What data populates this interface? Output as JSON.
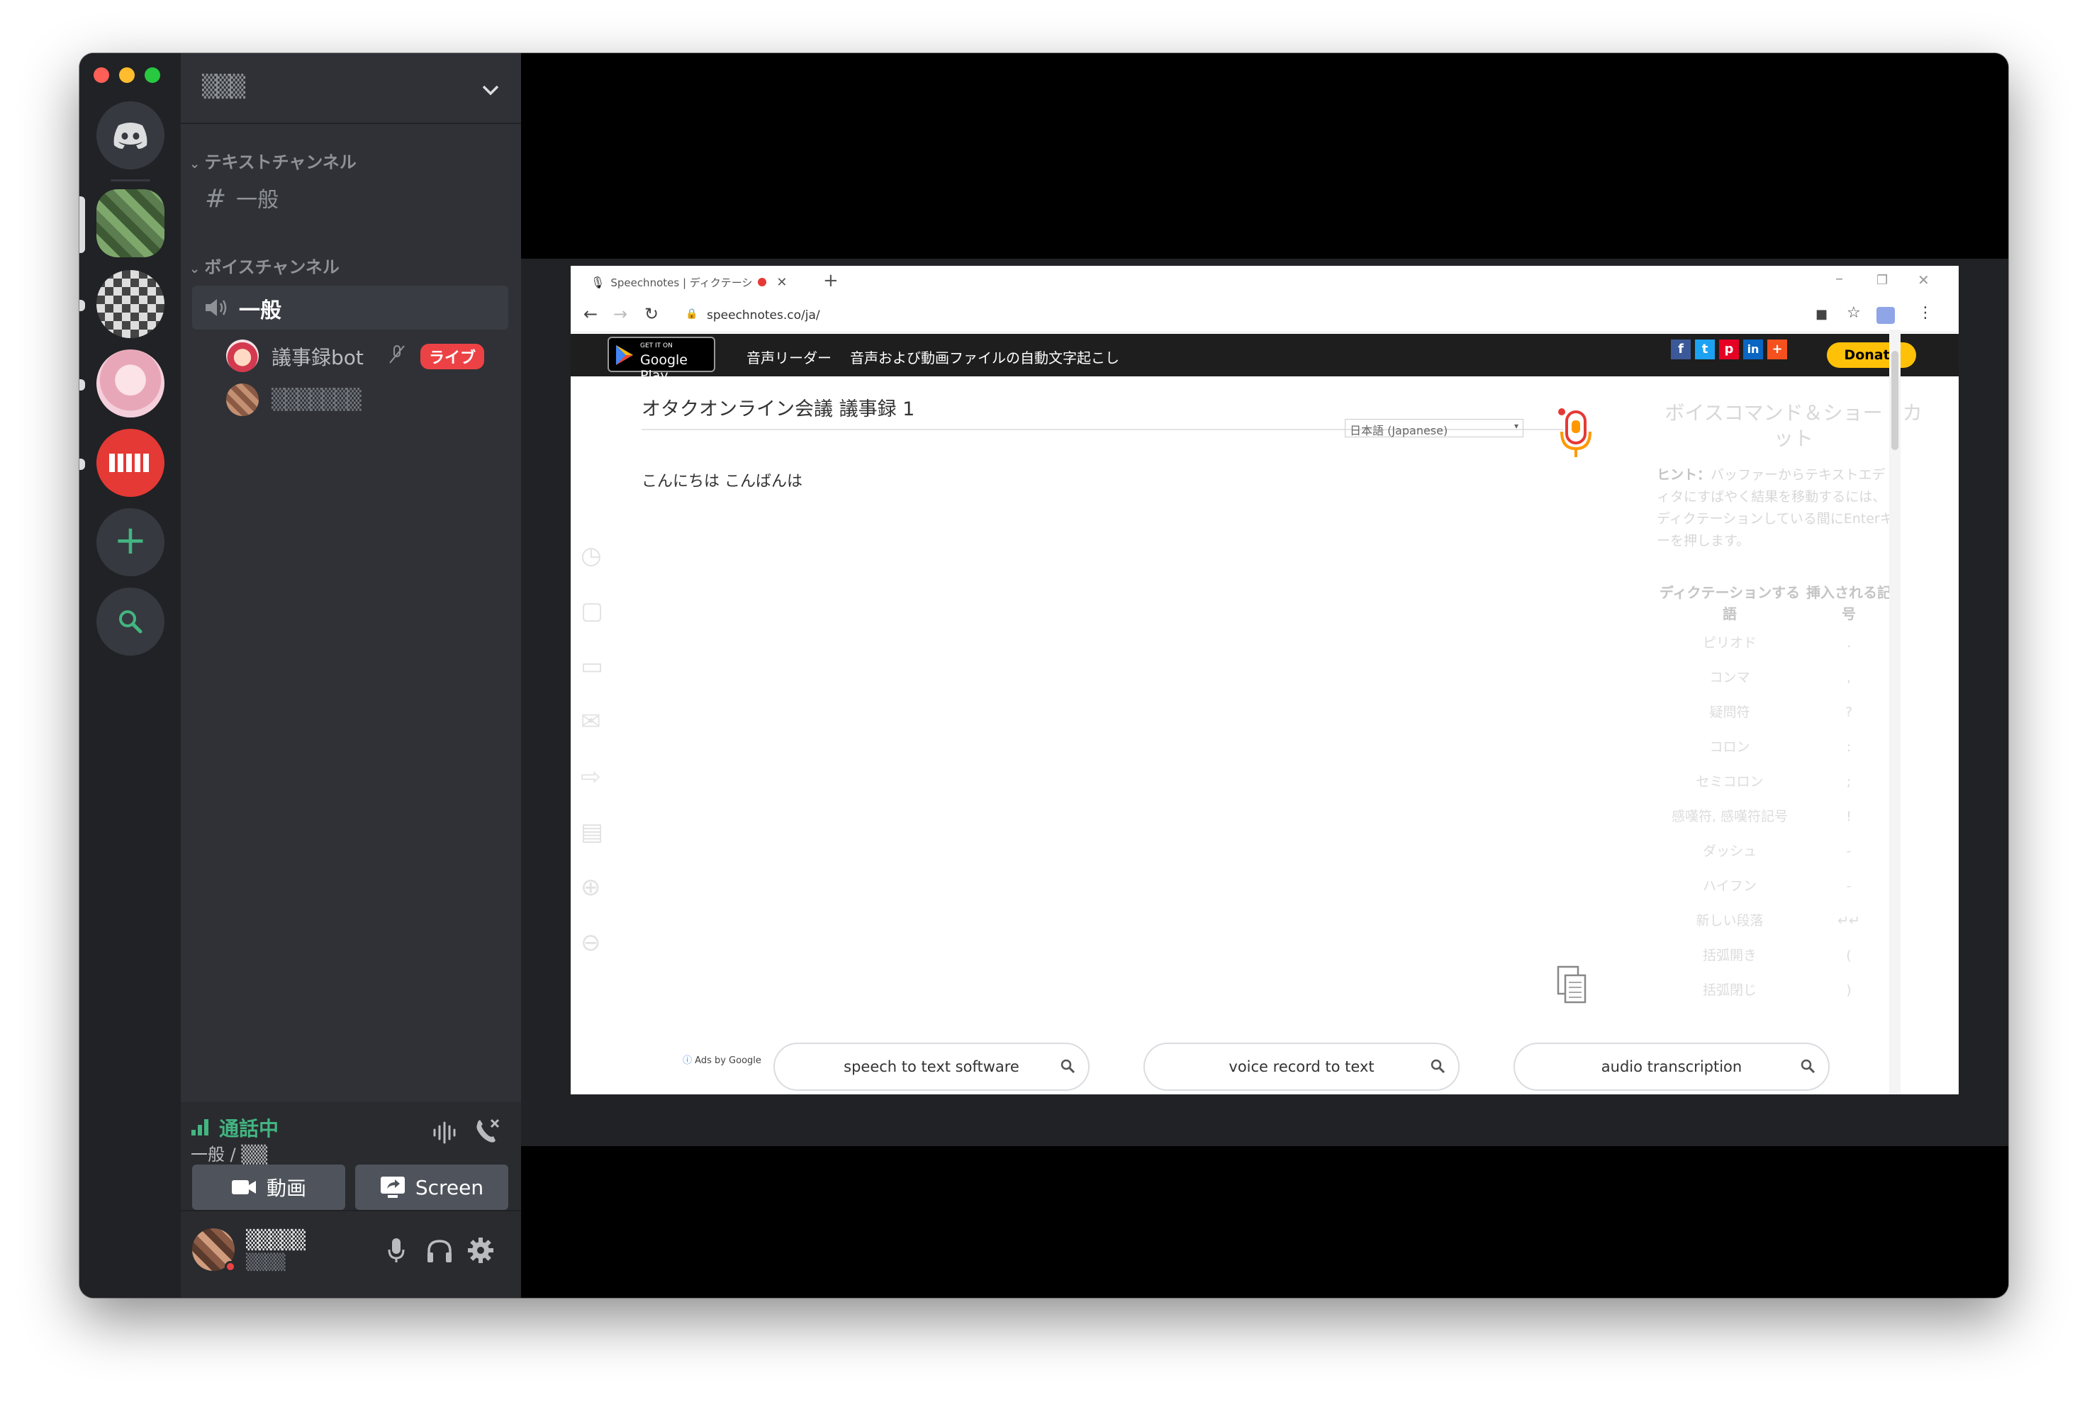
{
  "discord": {
    "server_name": "▒▒▒",
    "categories": {
      "text": "テキストチャンネル",
      "voice": "ボイスチャンネル"
    },
    "text_channel": "一般",
    "voice_channel": "一般",
    "voice_users": [
      {
        "name": "議事録bot",
        "badge": "ライブ"
      },
      {
        "name": "▒▒▒▒▒▒▒"
      }
    ],
    "voice_status": {
      "title": "通話中",
      "subtitle": "一般 / ▒▒"
    },
    "buttons": {
      "video": "動画",
      "screen": "Screen"
    },
    "user": {
      "name": "▒▒▒▒▒",
      "tag": "▒▒▒▒"
    },
    "colors": {
      "green": "#43b581",
      "live": "#ed4245",
      "blurple": "#5865f2"
    }
  },
  "browser": {
    "tab_title": "Speechnotes | ディクテーション",
    "url": "speechnotes.co/ja/",
    "google_play": {
      "small": "GET IT ON",
      "big": "Google Play"
    },
    "nav": [
      "音声リーダー",
      "音声および動画ファイルの自動文字起こし"
    ],
    "social": [
      "f",
      "t",
      "p",
      "in",
      "+"
    ],
    "donate": "Donate"
  },
  "speechnotes": {
    "title": "オタクオンライン会議 議事録 1",
    "language": "日本語 (Japanese)",
    "body": "こんにちは こんばんは",
    "panel_title": "ボイスコマンド＆ショートカット",
    "hint_label": "ヒント：",
    "hint_text": "バッファーからテキストエディタにすばやく結果を移動するには、ディクテーションしている間にEnterキーを押します。",
    "table_headers": [
      "ディクテーションする語",
      "挿入される記号"
    ],
    "commands": [
      {
        "word": "ピリオド",
        "symbol": "."
      },
      {
        "word": "コンマ",
        "symbol": ","
      },
      {
        "word": "疑問符",
        "symbol": "?"
      },
      {
        "word": "コロン",
        "symbol": ":"
      },
      {
        "word": "セミコロン",
        "symbol": ";"
      },
      {
        "word": "感嘆符, 感嘆符記号",
        "symbol": "!"
      },
      {
        "word": "ダッシュ",
        "symbol": "-"
      },
      {
        "word": "ハイフン",
        "symbol": "-"
      },
      {
        "word": "新しい段落",
        "symbol": "↵↵"
      },
      {
        "word": "括弧開き",
        "symbol": "("
      },
      {
        "word": "括弧閉じ",
        "symbol": ")"
      }
    ],
    "ads_label": "Ads by Google",
    "ads": [
      "speech to text software",
      "voice record to text",
      "audio transcription"
    ]
  }
}
